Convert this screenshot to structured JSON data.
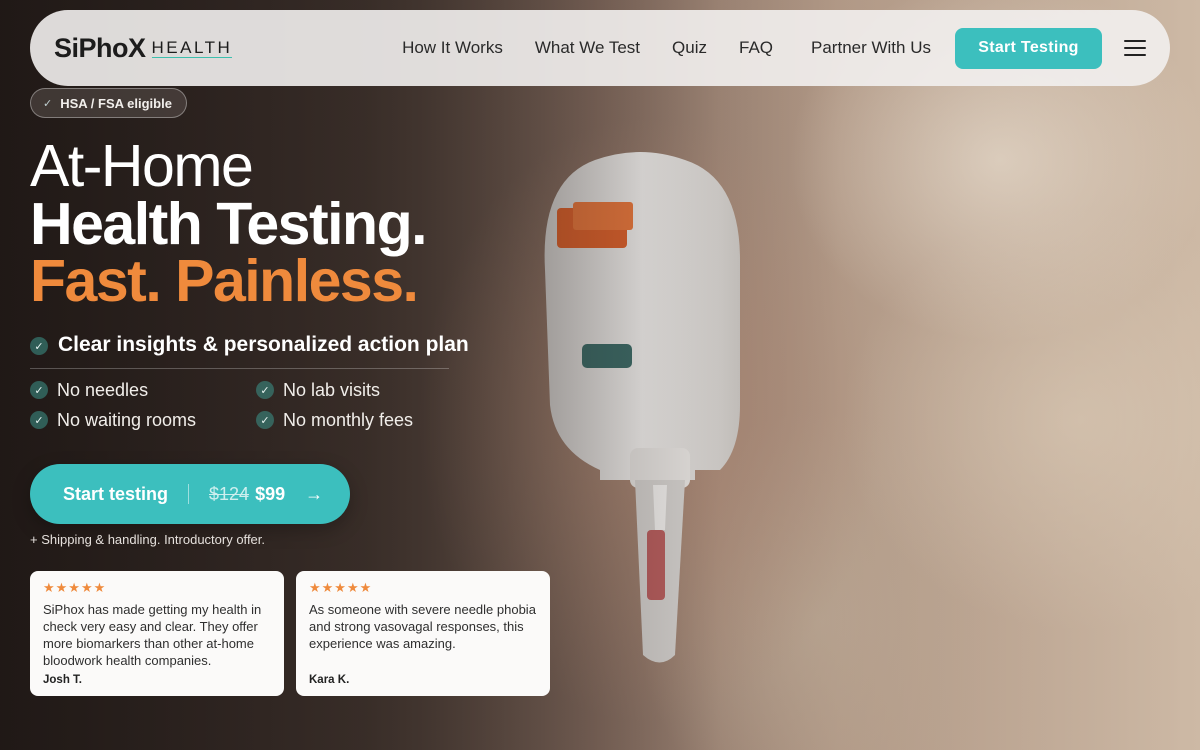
{
  "colors": {
    "accent": "#3cbfbe",
    "orange": "#ef8a3c",
    "nav_bg": "#f2f0ee"
  },
  "nav": {
    "logo_name": "SiPhoX",
    "logo_sub": "HEALTH",
    "links": [
      "How It Works",
      "What We Test",
      "Quiz",
      "FAQ",
      "Partner With Us"
    ],
    "cta_label": "Start Testing",
    "menu_icon": "hamburger-icon"
  },
  "hero": {
    "badge": "HSA / FSA eligible",
    "headline_1": "At-Home",
    "headline_2": "Health Testing.",
    "headline_3": "Fast. Painless.",
    "main_point": "Clear insights & personalized action plan",
    "features": [
      "No needles",
      "No lab visits",
      "No waiting rooms",
      "No monthly fees"
    ],
    "cta": {
      "label": "Start testing",
      "old_price": "$124",
      "new_price": "$99"
    },
    "shipping_note": "+ Shipping & handling. Introductory offer."
  },
  "reviews": [
    {
      "rating": 5,
      "stars": "★★★★★",
      "text": "SiPhox has made getting my health in check very easy and clear. They offer more biomarkers than other at-home bloodwork health companies.",
      "author": "Josh T."
    },
    {
      "rating": 5,
      "stars": "★★★★★",
      "text": "As someone with severe needle phobia and strong vasovagal responses, this experience was amazing.",
      "author": "Kara K."
    }
  ]
}
